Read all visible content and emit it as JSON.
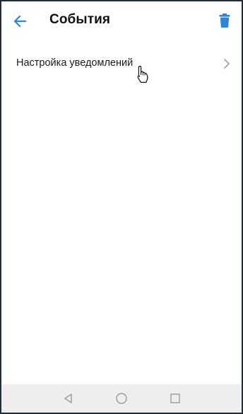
{
  "header": {
    "title": "События",
    "back_icon": "arrow-back-icon",
    "delete_icon": "trash-icon"
  },
  "list": {
    "items": [
      {
        "label": "Настройка уведомлений",
        "trailing_icon": "chevron-right-icon"
      }
    ]
  },
  "system_nav": {
    "back_icon": "nav-back-icon",
    "home_icon": "nav-home-icon",
    "recents_icon": "nav-recents-icon"
  },
  "colors": {
    "accent": "#2f86d6",
    "text": "#1a1a1a",
    "nav_bar": "#eeeeef",
    "nav_icon": "#9a9a9a",
    "border": "#1f2d3a"
  }
}
